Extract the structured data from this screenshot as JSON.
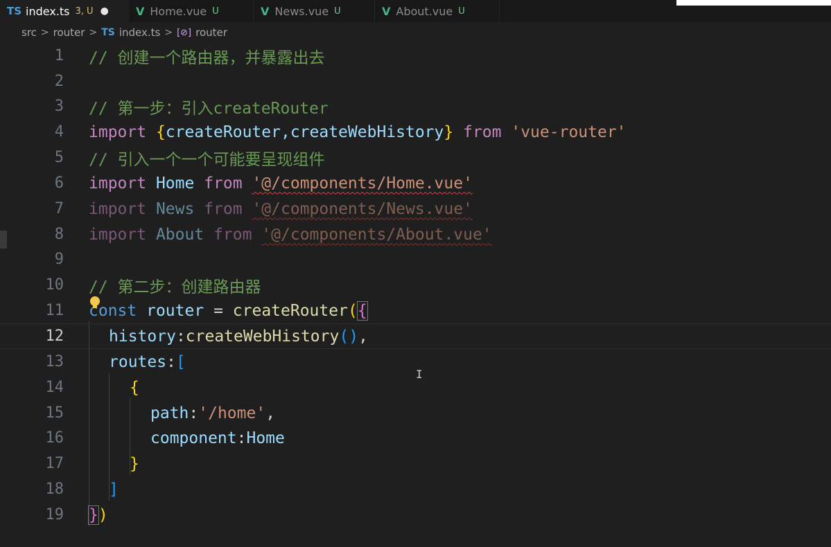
{
  "tabs": [
    {
      "icon": "TS",
      "label": "index.ts",
      "status": "3, U",
      "modified": "●",
      "active": true
    },
    {
      "icon": "V",
      "label": "Home.vue",
      "status": "U",
      "active": false
    },
    {
      "icon": "V",
      "label": "News.vue",
      "status": "U",
      "active": false
    },
    {
      "icon": "V",
      "label": "About.vue",
      "status": "U",
      "active": false
    }
  ],
  "breadcrumb": {
    "src": "src",
    "router": "router",
    "ts_icon": "TS",
    "file": "index.ts",
    "symbol_icon": "[⊘]",
    "symbol": "router",
    "sep": ">"
  },
  "lines": [
    {
      "n": "1"
    },
    {
      "n": "2"
    },
    {
      "n": "3"
    },
    {
      "n": "4"
    },
    {
      "n": "5"
    },
    {
      "n": "6"
    },
    {
      "n": "7"
    },
    {
      "n": "8"
    },
    {
      "n": "9"
    },
    {
      "n": "10"
    },
    {
      "n": "11"
    },
    {
      "n": "12"
    },
    {
      "n": "13"
    },
    {
      "n": "14"
    },
    {
      "n": "15"
    },
    {
      "n": "16"
    },
    {
      "n": "17"
    },
    {
      "n": "18"
    },
    {
      "n": "19"
    }
  ],
  "code": {
    "l1": "// 创建一个路由器，并暴露出去",
    "l3": "// 第一步：引入createRouter",
    "l4_import": "import",
    "l4_open": "{",
    "l4_names": "createRouter,createWebHistory",
    "l4_close": "}",
    "l4_from": "from",
    "l4_src": "'vue-router'",
    "l5": "// 引入一个一个可能要呈现组件",
    "l6_import": "import",
    "l6_name": "Home",
    "l6_from": "from",
    "l6_src": "'@/components/Home.vue'",
    "l7_import": "import",
    "l7_name": "News",
    "l7_from": "from",
    "l7_src": "'@/components/News.vue'",
    "l8_import": "import",
    "l8_name": "About",
    "l8_from": "from",
    "l8_src": "'@/components/About.vue'",
    "l10": "// 第二步：创建路由器",
    "l11_const": "const",
    "l11_var": "router",
    "l11_eq": "=",
    "l11_fn": "createRouter",
    "l11_paren": "(",
    "l11_brace": "{",
    "l12_key": "history",
    "l12_colon": ":",
    "l12_fn": "createWebHistory",
    "l12_parens": "()",
    "l12_comma": ",",
    "l13_key": "routes",
    "l13_colon": ":",
    "l13_bracket": "[",
    "l14_brace": "{",
    "l15_key": "path",
    "l15_colon": ":",
    "l15_val": "'/home'",
    "l15_comma": ",",
    "l16_key": "component",
    "l16_colon": ":",
    "l16_val": "Home",
    "l17_brace": "}",
    "l18_bracket": "]",
    "l19_brace": "}",
    "l19_paren": ")"
  },
  "current_line": "12",
  "colors": {
    "comment": "#6a9955",
    "keyword": "#569cd6",
    "import": "#c586c0",
    "string": "#ce9178",
    "variable": "#9cdcfe",
    "function": "#dcdcaa",
    "bracket1": "#ffd700",
    "bracket2": "#da70d6",
    "bracket3": "#179fff"
  },
  "icons": [
    "typescript-file-icon",
    "vue-file-icon",
    "symbol-variable-icon",
    "lightbulb-icon",
    "text-cursor-icon"
  ]
}
